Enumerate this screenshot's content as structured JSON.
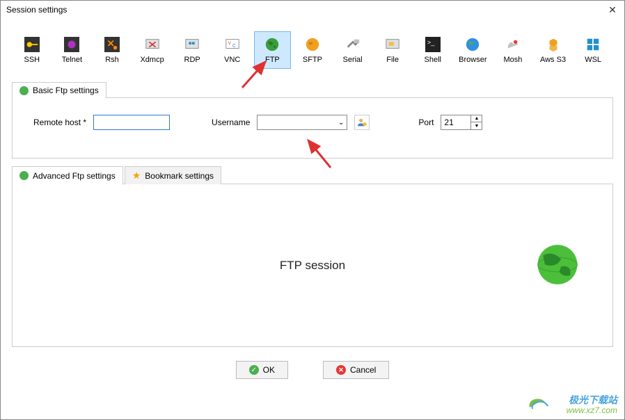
{
  "window": {
    "title": "Session settings"
  },
  "protocols": [
    {
      "label": "SSH"
    },
    {
      "label": "Telnet"
    },
    {
      "label": "Rsh"
    },
    {
      "label": "Xdmcp"
    },
    {
      "label": "RDP"
    },
    {
      "label": "VNC"
    },
    {
      "label": "FTP"
    },
    {
      "label": "SFTP"
    },
    {
      "label": "Serial"
    },
    {
      "label": "File"
    },
    {
      "label": "Shell"
    },
    {
      "label": "Browser"
    },
    {
      "label": "Mosh"
    },
    {
      "label": "Aws S3"
    },
    {
      "label": "WSL"
    }
  ],
  "tabs": {
    "basic": "Basic Ftp settings",
    "advanced": "Advanced Ftp settings",
    "bookmark": "Bookmark settings"
  },
  "fields": {
    "remote_host_label": "Remote host *",
    "remote_host_value": "",
    "username_label": "Username",
    "username_value": "",
    "port_label": "Port",
    "port_value": "21"
  },
  "session_body": "FTP session",
  "buttons": {
    "ok": "OK",
    "cancel": "Cancel"
  },
  "watermark": {
    "line1": "极光下载站",
    "line2": "www.xz7.com"
  }
}
